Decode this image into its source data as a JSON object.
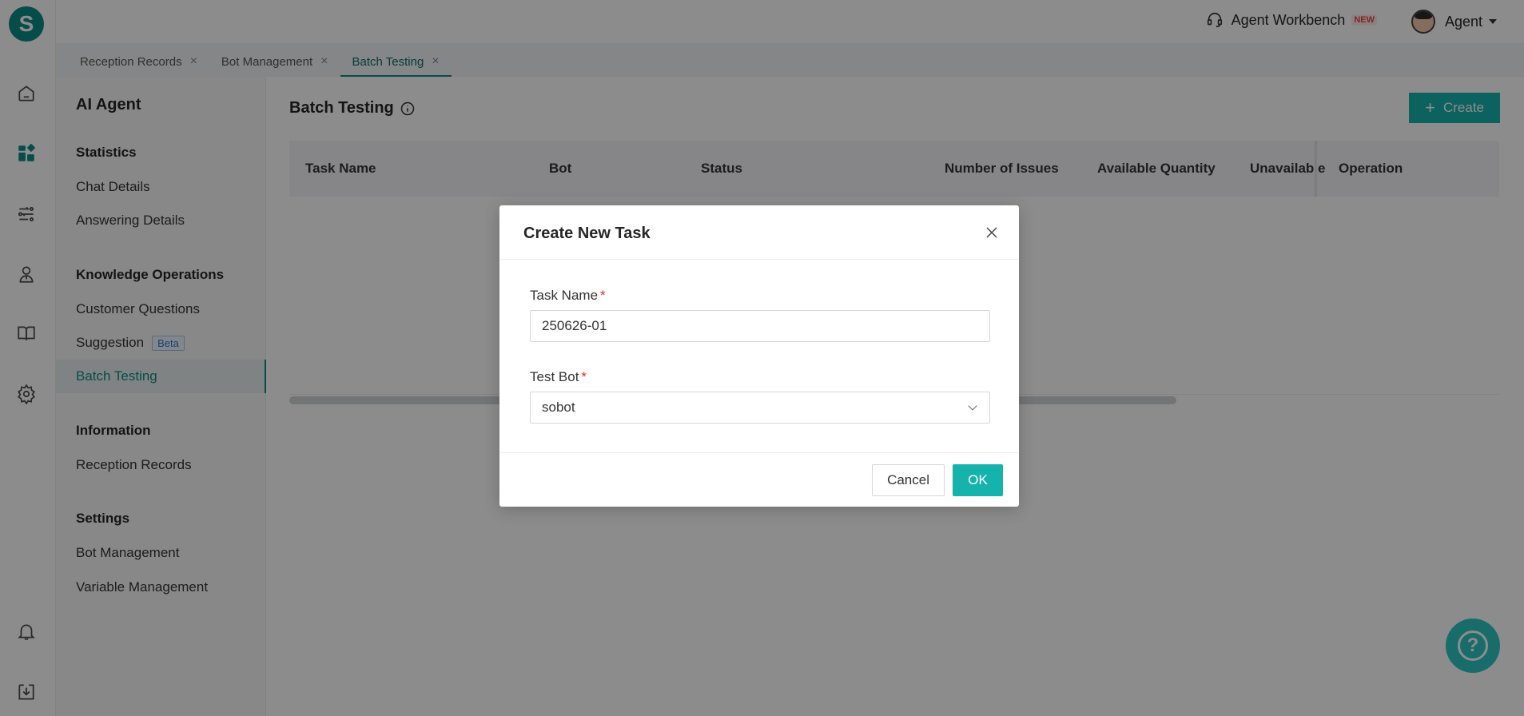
{
  "app": {
    "logo_letter": "S",
    "accent_color": "#16b3ad",
    "workbench_label": "Agent Workbench",
    "workbench_badge": "NEW",
    "user_label": "Agent"
  },
  "rail_icons": [
    "home-icon",
    "dashboard-icon",
    "flow-icon",
    "agent-icon",
    "book-icon",
    "gear-icon",
    "bell-icon",
    "download-icon"
  ],
  "tabs": [
    {
      "label": "Reception Records"
    },
    {
      "label": "Bot Management"
    },
    {
      "label": "Batch Testing"
    }
  ],
  "sidebar": {
    "title": "AI Agent",
    "groups": [
      {
        "label": "Statistics"
      },
      {
        "label": "Knowledge Operations"
      },
      {
        "label": "Information"
      },
      {
        "label": "Settings"
      }
    ],
    "items": [
      {
        "label": "Chat Details"
      },
      {
        "label": "Answering Details"
      },
      {
        "label": "Customer Questions"
      },
      {
        "label": "Suggestion",
        "badge": "Beta"
      },
      {
        "label": "Batch Testing"
      },
      {
        "label": "Reception Records"
      },
      {
        "label": "Bot Management"
      },
      {
        "label": "Variable Management"
      }
    ]
  },
  "main": {
    "title": "Batch Testing",
    "create_label": "Create",
    "columns": [
      {
        "label": "Task Name"
      },
      {
        "label": "Bot"
      },
      {
        "label": "Status"
      },
      {
        "label": "Number of Issues"
      },
      {
        "label": "Available Quantity"
      },
      {
        "label": "Unavailable"
      },
      {
        "label": "Operation"
      }
    ]
  },
  "help_label": "?",
  "modal": {
    "title": "Create New Task",
    "task_name_label": "Task Name",
    "task_name_value": "250626-01",
    "test_bot_label": "Test Bot",
    "test_bot_value": "sobot",
    "required_mark": "*",
    "cancel_label": "Cancel",
    "ok_label": "OK"
  }
}
